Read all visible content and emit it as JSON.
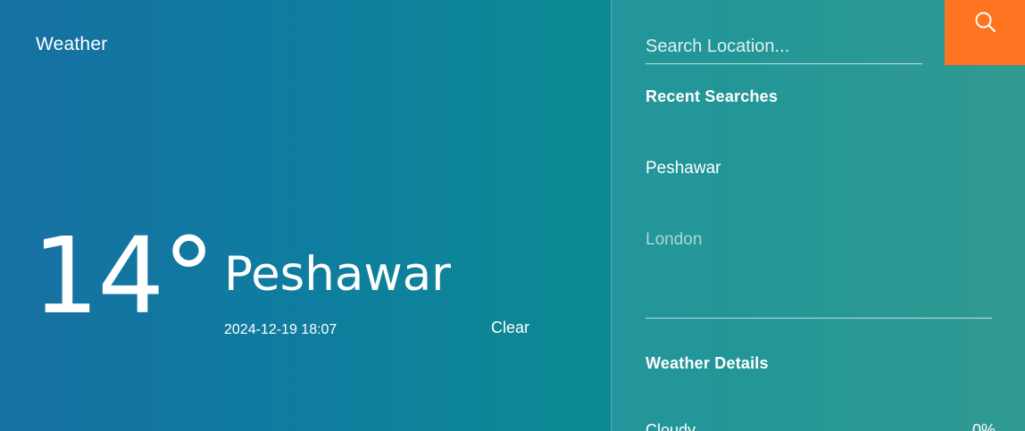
{
  "app": {
    "brand": "Weather"
  },
  "current": {
    "temperature": "14°",
    "city": "Peshawar",
    "datetime": "2024-12-19 18:07",
    "clear_label": "Clear"
  },
  "search": {
    "placeholder": "Search Location..."
  },
  "recent": {
    "title": "Recent Searches",
    "items": [
      {
        "label": "Peshawar"
      },
      {
        "label": "London"
      }
    ]
  },
  "details": {
    "title": "Weather Details",
    "rows": [
      {
        "label": "Cloudy",
        "value": "0%"
      }
    ]
  },
  "colors": {
    "accent": "#ff7421",
    "gradient_start": "#1670a3",
    "gradient_end": "#1a8f86"
  },
  "icons": {
    "search": "search-icon"
  }
}
